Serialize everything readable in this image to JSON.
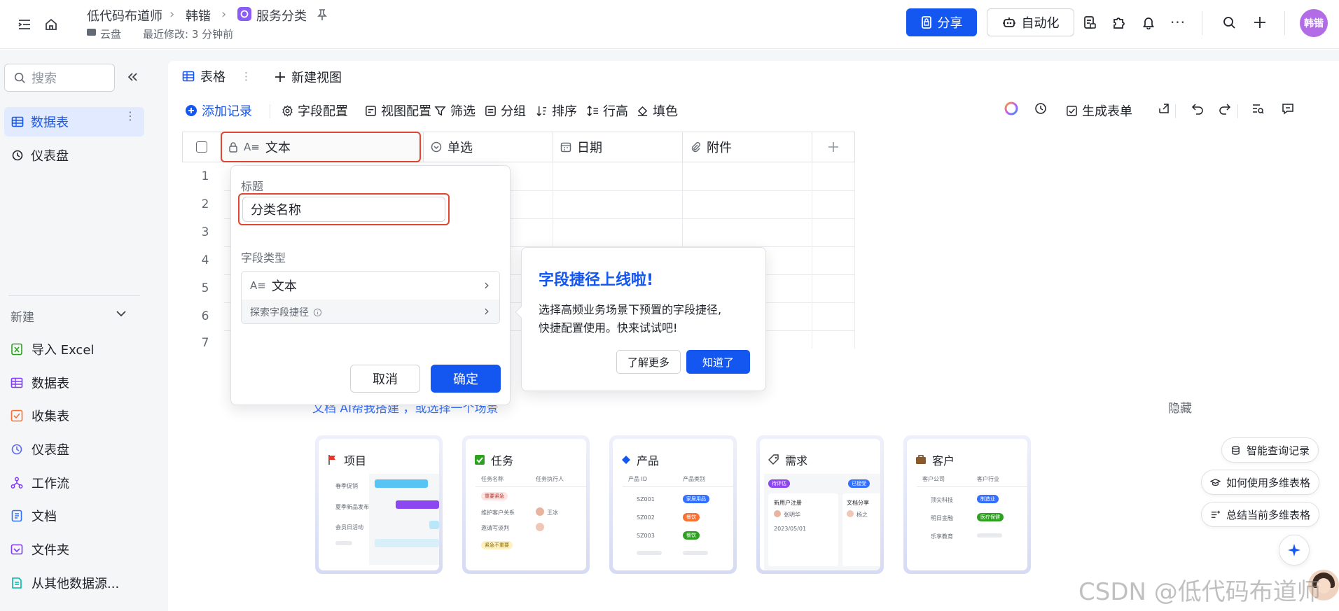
{
  "header": {
    "breadcrumb": [
      "低代码布道师",
      "韩锴",
      "服务分类"
    ],
    "location": "云盘",
    "last_modified": "最近修改: 3 分钟前",
    "share_label": "分享",
    "automation_label": "自动化",
    "avatar_text": "韩锴"
  },
  "sidebar": {
    "search_placeholder": "搜索",
    "items": [
      {
        "label": "数据表",
        "active": true
      },
      {
        "label": "仪表盘",
        "active": false
      }
    ],
    "new_section_label": "新建",
    "new_items": [
      {
        "label": "导入 Excel",
        "icon": "excel-icon",
        "color": "#2ea121"
      },
      {
        "label": "数据表",
        "icon": "table-icon",
        "color": "#7f3bf5"
      },
      {
        "label": "收集表",
        "icon": "form-icon",
        "color": "#f77234"
      },
      {
        "label": "仪表盘",
        "icon": "dashboard-icon",
        "color": "#5b65f5"
      },
      {
        "label": "工作流",
        "icon": "workflow-icon",
        "color": "#7f3bf5"
      },
      {
        "label": "文档",
        "icon": "doc-icon",
        "color": "#3370ff"
      },
      {
        "label": "文件夹",
        "icon": "folder-icon",
        "color": "#7f3bf5"
      },
      {
        "label": "从其他数据源...",
        "icon": "datasource-icon",
        "color": "#00b8a9"
      }
    ]
  },
  "views": {
    "active_tab": "表格",
    "new_view_label": "新建视图"
  },
  "toolbar": {
    "add_record": "添加记录",
    "field_config": "字段配置",
    "view_config": "视图配置",
    "filter": "筛选",
    "group": "分组",
    "sort": "排序",
    "row_height": "行高",
    "fill_color": "填色",
    "generate_form": "生成表单"
  },
  "grid": {
    "columns": [
      "文本",
      "单选",
      "日期",
      "附件"
    ],
    "row_numbers": [
      "1",
      "2",
      "3",
      "4",
      "5",
      "6",
      "7"
    ]
  },
  "field_popup": {
    "title_label": "标题",
    "title_value": "分类名称",
    "type_label": "字段类型",
    "type_value": "文本",
    "explore_label": "探索字段捷径",
    "cancel_label": "取消",
    "ok_label": "确定"
  },
  "tip": {
    "title": "字段捷径上线啦!",
    "body_line1": "选择高频业务场景下预置的字段捷径,",
    "body_line2": "快捷配置使用。快来试试吧!",
    "learn_more": "了解更多",
    "got_it": "知道了"
  },
  "ai_banner": {
    "hint_fragment": "文档 AI帮我搭建 ，或选择一个场景",
    "hide_label": "隐藏"
  },
  "templates": [
    {
      "title": "项目",
      "rows": [
        "春季促销",
        "夏季新品发布",
        "会员日活动"
      ]
    },
    {
      "title": "任务",
      "headers": [
        "任务名称",
        "任务执行人"
      ],
      "badge1": "重要紧急",
      "rows": [
        "维护客户关系",
        "邀请写谈判"
      ],
      "people": [
        "王冰"
      ],
      "badge2": "紧急不重要"
    },
    {
      "title": "产品",
      "headers": [
        "产品 ID",
        "产品类别"
      ],
      "ids": [
        "SZ001",
        "SZ002",
        "SZ003"
      ],
      "tags": [
        "家居用品",
        "餐饮",
        "餐饮"
      ]
    },
    {
      "title": "需求",
      "pill1": "待评估",
      "pill2": "已接受",
      "card1": "新用户注册",
      "card1_user": "张明华",
      "card1_date": "2023/05/01",
      "card2": "文档分享",
      "card2_user": "杨之"
    },
    {
      "title": "客户",
      "headers": [
        "客户公司",
        "客户行业"
      ],
      "rows": [
        "顶尖科技",
        "明日金融",
        "乐享教育"
      ],
      "tags": [
        "制造业",
        "医疗保健"
      ]
    }
  ],
  "right_actions": [
    "智能查询记录",
    "如何使用多维表格",
    "总结当前多维表格"
  ],
  "watermark": "CSDN @低代码布道师",
  "colors": {
    "brand": "#1456f0",
    "highlight": "#e14630",
    "avatar": "#b26ce5"
  }
}
